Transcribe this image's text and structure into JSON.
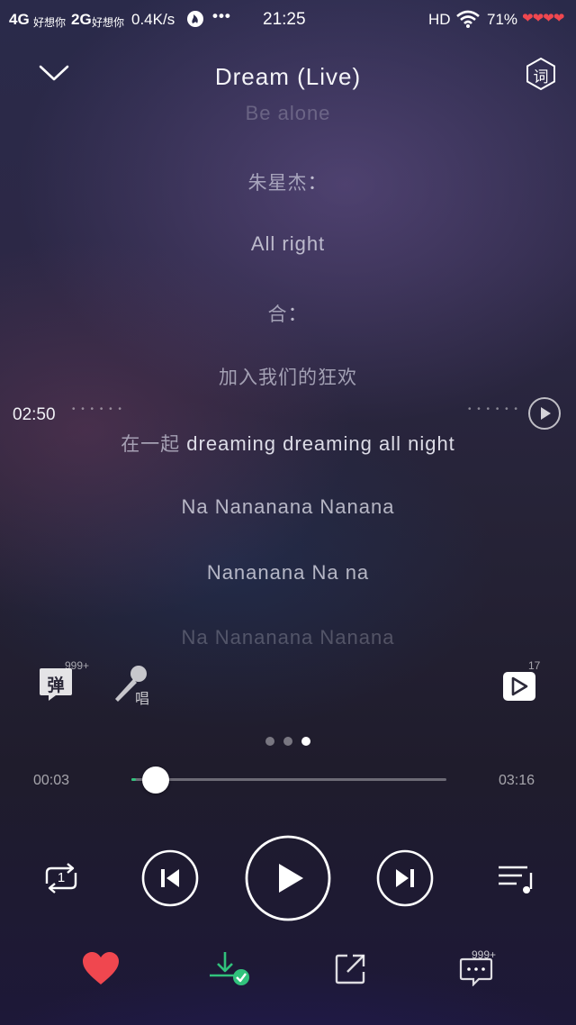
{
  "status_bar": {
    "network1": "4G",
    "carrier1": "好想你",
    "network2": "2G",
    "carrier2": "好想你",
    "speed": "0.4K/s",
    "more": "•••",
    "time": "21:25",
    "hd": "HD",
    "battery": "71%",
    "hearts": "❤❤❤❤"
  },
  "header": {
    "title": "Dream (Live)",
    "lyric_button_label": "词"
  },
  "lyrics": {
    "lines": [
      {
        "cjk": "",
        "text": "Be alone"
      },
      {
        "cjk": "朱星杰",
        "text": "："
      },
      {
        "cjk": "",
        "text": "All right"
      },
      {
        "cjk": "合",
        "text": "："
      },
      {
        "cjk": "加入我们的狂欢",
        "text": ""
      },
      {
        "cjk": "在一起",
        "text": " dreaming dreaming all night"
      },
      {
        "cjk": "",
        "text": "Na Nananana Nanana"
      },
      {
        "cjk": "",
        "text": "Nananana Na na"
      },
      {
        "cjk": "",
        "text": "Na Nananana Nanana"
      }
    ],
    "seek_time": "02:50",
    "seek_dots": "• • • • • •"
  },
  "tools": {
    "danmaku_label": "弹",
    "danmaku_count": "999+",
    "sing_label": "唱",
    "video_count": "17"
  },
  "pager": {
    "count": 3,
    "active": 2
  },
  "progress": {
    "current": "00:03",
    "total": "03:16",
    "fraction": 0.015,
    "accent_color": "#31c27c"
  },
  "controls": {
    "loop_number": "1"
  },
  "actions": {
    "favorite_color": "#f0474f",
    "comment_count": "999+",
    "download_check_color": "#31c27c"
  }
}
